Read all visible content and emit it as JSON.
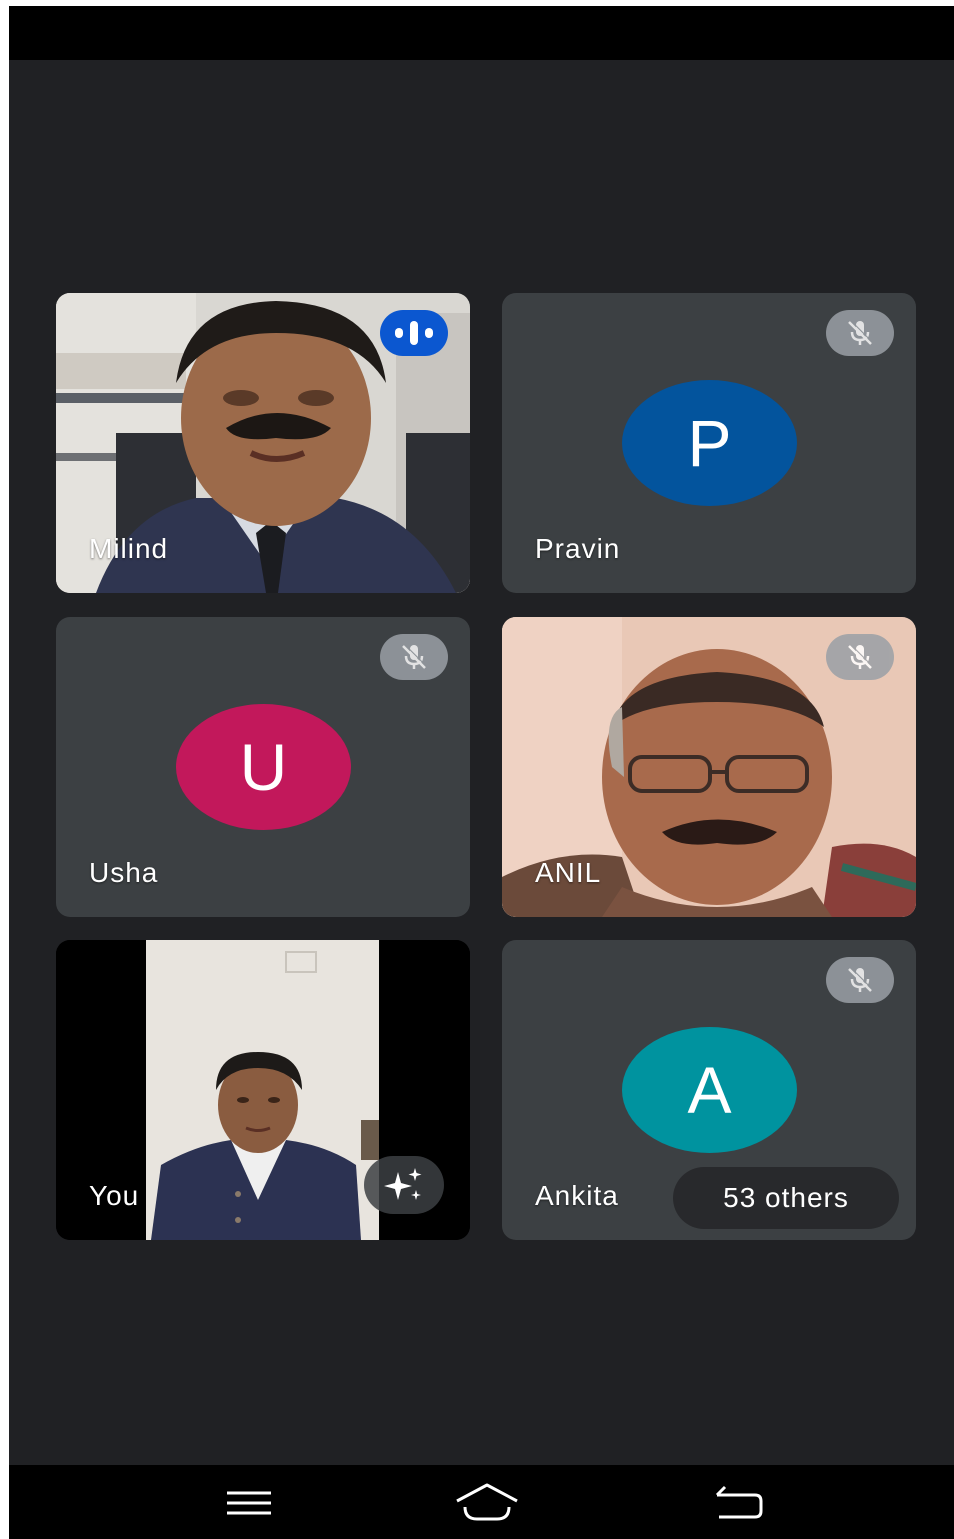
{
  "meeting": {
    "participants": [
      {
        "name": "Milind",
        "type": "video",
        "status": "speaking",
        "status_icon": "speaking-icon"
      },
      {
        "name": "Pravin",
        "type": "avatar",
        "initial": "P",
        "avatar_color": "#03549d",
        "status": "muted",
        "status_icon": "mic-off-icon"
      },
      {
        "name": "Usha",
        "type": "avatar",
        "initial": "U",
        "avatar_color": "#c2185b",
        "status": "muted",
        "status_icon": "mic-off-icon"
      },
      {
        "name": "ANIL",
        "type": "video",
        "status": "muted",
        "status_icon": "mic-off-icon"
      },
      {
        "name": "You",
        "type": "video",
        "status": "self",
        "status_icon": "sparkle-icon"
      },
      {
        "name": "Ankita",
        "type": "avatar",
        "initial": "A",
        "avatar_color": "#00939f",
        "status": "muted",
        "status_icon": "mic-off-icon"
      }
    ],
    "others_label": "53 others"
  },
  "colors": {
    "background": "#202124",
    "tile": "#3c4043",
    "speaking_badge": "#0b57d0",
    "mute_badge": "#9aa0a6"
  },
  "nav": {
    "items": [
      {
        "icon": "menu-icon"
      },
      {
        "icon": "home-icon"
      },
      {
        "icon": "back-icon"
      }
    ]
  }
}
